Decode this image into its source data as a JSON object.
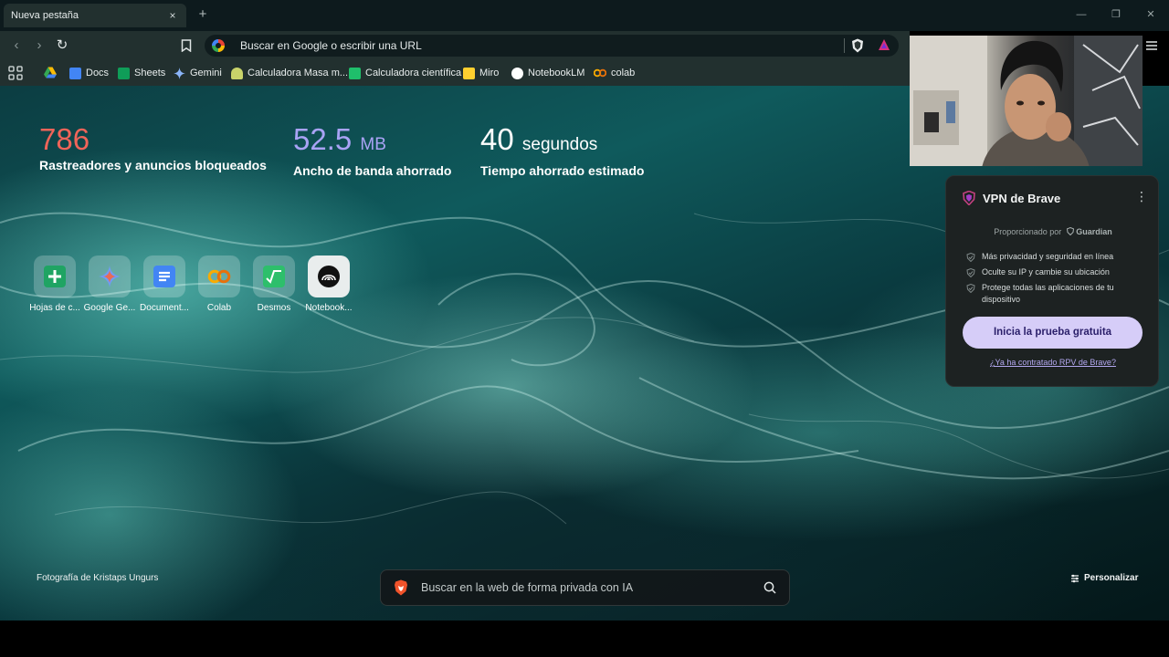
{
  "window": {
    "tab_title": "Nueva pestaña",
    "close_tab_glyph": "×",
    "new_tab_glyph": "+",
    "minimize_glyph": "—",
    "maximize_glyph": "❐",
    "close_window_glyph": "✕"
  },
  "toolbar": {
    "back_glyph": "‹",
    "forward_glyph": "›",
    "reload_glyph": "↻",
    "omnibox_placeholder": "Buscar en Google o escribir una URL"
  },
  "bookmarks": [
    {
      "label": "Docs",
      "icon": "google-docs-icon",
      "color": "#4285f4"
    },
    {
      "label": "Sheets",
      "icon": "google-sheets-icon",
      "color": "#0f9d58"
    },
    {
      "label": "Gemini",
      "icon": "gemini-icon",
      "color": "#8ab4f8"
    },
    {
      "label": "Calculadora Masa m...",
      "icon": "calculator-site-icon",
      "color": "#c9d36a"
    },
    {
      "label": "Calculadora científica",
      "icon": "calculator-science-icon",
      "color": "#1fbf6b"
    },
    {
      "label": "Miro",
      "icon": "miro-icon",
      "color": "#ffd02f"
    },
    {
      "label": "NotebookLM",
      "icon": "notebooklm-icon",
      "color": "#ffffff"
    },
    {
      "label": "colab",
      "icon": "colab-icon",
      "color": "#f9ab00"
    }
  ],
  "stats": {
    "trackers": {
      "value": "786",
      "label": "Rastreadores y anuncios bloqueados",
      "color": "#f06459"
    },
    "bandwidth": {
      "value": "52.5",
      "unit": "MB",
      "label": "Ancho de banda ahorrado",
      "color": "#a9a3f5"
    },
    "time": {
      "value": "40",
      "unit": "segundos",
      "label": "Tiempo ahorrado estimado",
      "color": "#ffffff"
    }
  },
  "top_sites": [
    {
      "label": "Hojas de c...",
      "icon": "google-sheets-icon"
    },
    {
      "label": "Google Ge...",
      "icon": "gemini-icon"
    },
    {
      "label": "Document...",
      "icon": "google-docs-icon"
    },
    {
      "label": "Colab",
      "icon": "colab-icon"
    },
    {
      "label": "Desmos",
      "icon": "desmos-icon"
    },
    {
      "label": "Notebook...",
      "icon": "notebooklm-icon"
    }
  ],
  "vpn": {
    "title": "VPN de Brave",
    "powered_by": "Proporcionado por",
    "powered_brand": "Guardian",
    "features": [
      "Más privacidad y seguridad en línea",
      "Oculte su IP y cambie su ubicación",
      "Protege todas las aplicaciones de tu dispositivo"
    ],
    "cta": "Inicia la prueba gratuita",
    "link": "¿Ya ha contratado RPV de Brave?",
    "more_glyph": "⋮"
  },
  "footer": {
    "photo_credit": "Fotografía de Kristaps Ungurs",
    "search_placeholder": "Buscar en la web de forma privada con IA",
    "customize": "Personalizar"
  }
}
